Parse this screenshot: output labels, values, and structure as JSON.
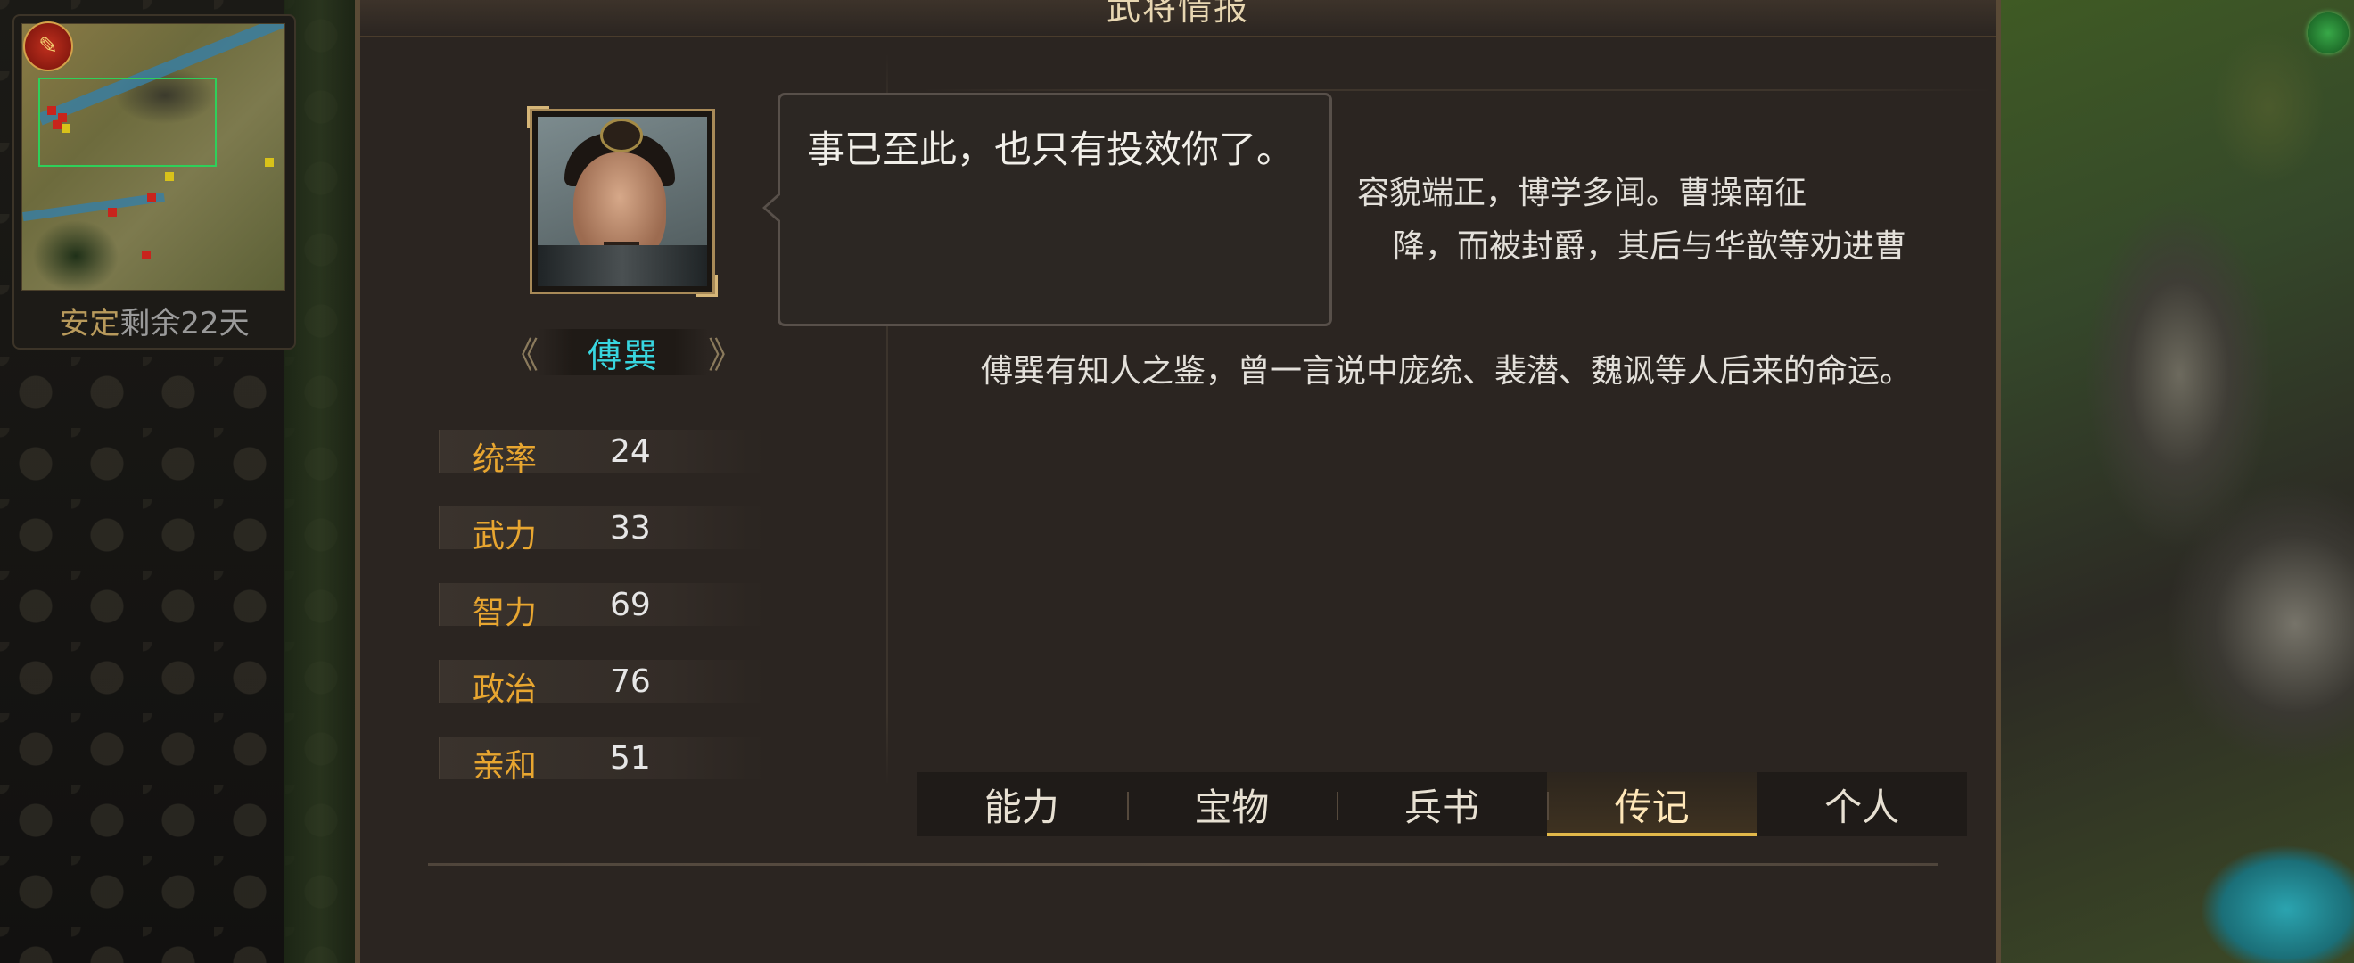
{
  "window": {
    "title": "武将情报"
  },
  "minimap": {
    "status_label": "安定",
    "status_remaining": "剩余22天"
  },
  "general": {
    "name": "傅巽"
  },
  "stats": [
    {
      "label": "统率",
      "value": "24"
    },
    {
      "label": "武力",
      "value": "33"
    },
    {
      "label": "智力",
      "value": "69"
    },
    {
      "label": "政治",
      "value": "76"
    },
    {
      "label": "亲和",
      "value": "51"
    }
  ],
  "tooltip": {
    "text": "事已至此，也只有投效你了。"
  },
  "bio": {
    "p1_line1": "容貌端正，博学多闻。曹操南征",
    "p1_line2": "降，而被封爵，其后与华歆等劝进曹",
    "p2": "傅巽有知人之鉴，曾一言说中庞统、裴潜、魏讽等人后来的命运。"
  },
  "tabs": [
    {
      "label": "能力"
    },
    {
      "label": "宝物"
    },
    {
      "label": "兵书"
    },
    {
      "label": "传记",
      "active": true
    },
    {
      "label": "个人"
    }
  ],
  "colors": {
    "accent_gold": "#e8a630",
    "name_cyan": "#38d6e0",
    "tab_active_underline": "#e2b84a"
  }
}
